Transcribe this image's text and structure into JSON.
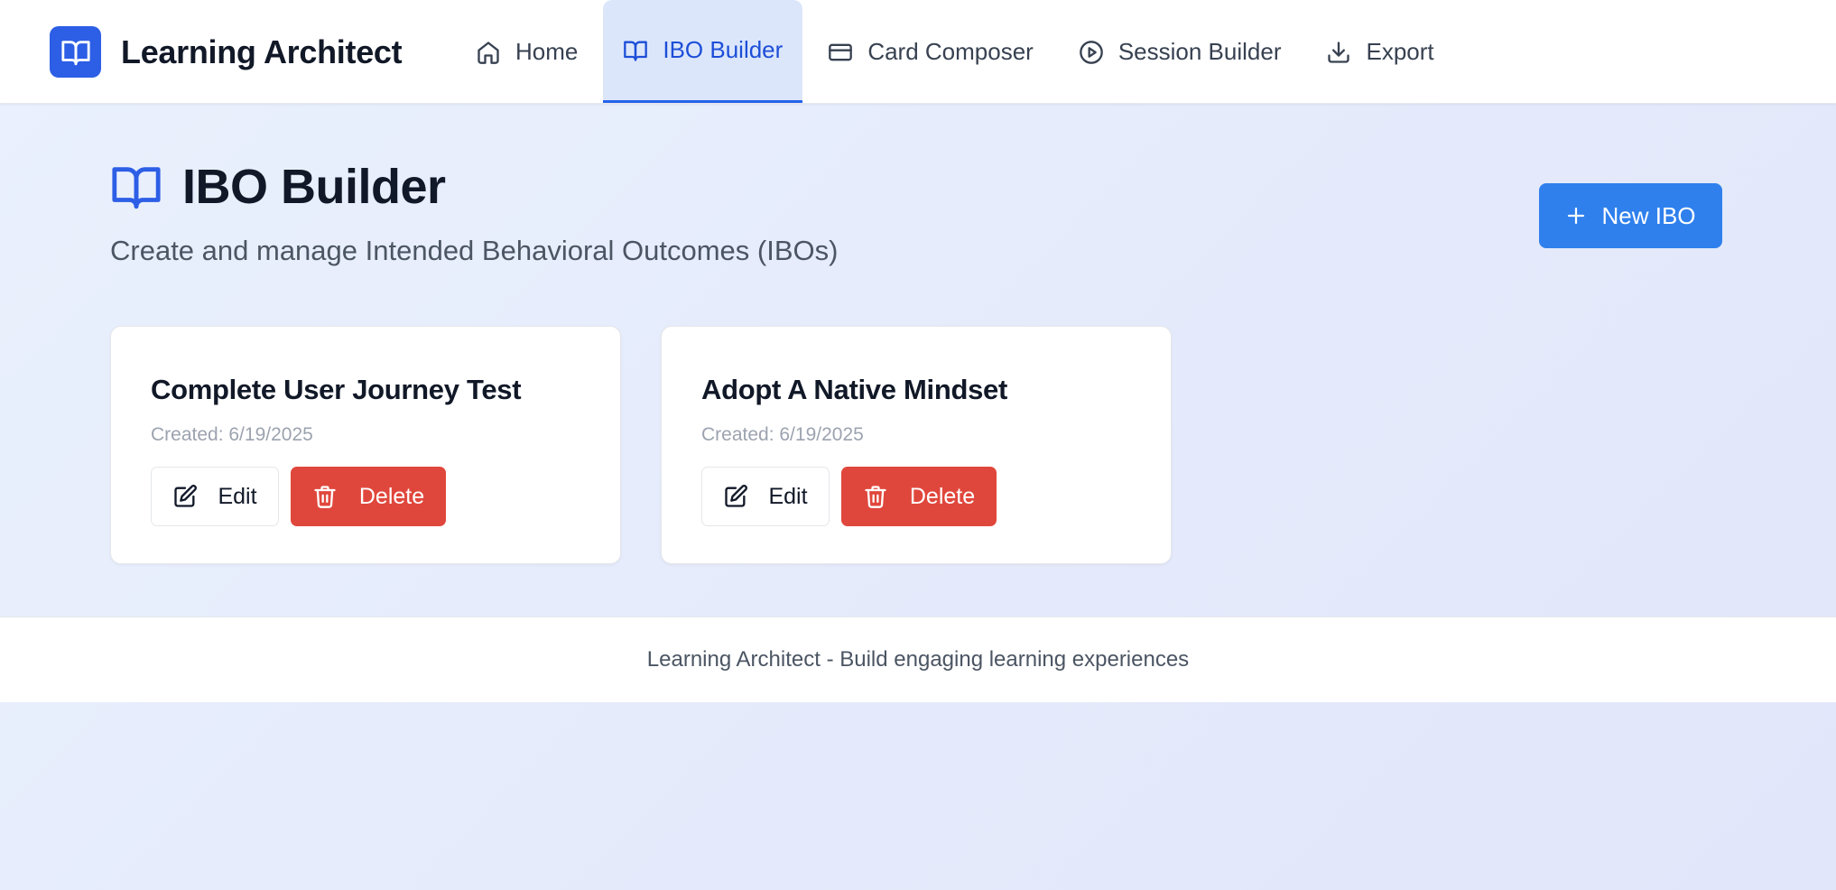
{
  "app": {
    "name": "Learning Architect",
    "logo_icon": "book-open-icon",
    "accent_color": "#2d5ee6"
  },
  "nav": {
    "items": [
      {
        "label": "Home",
        "icon": "home-icon",
        "active": false
      },
      {
        "label": "IBO Builder",
        "icon": "book-open-icon",
        "active": true
      },
      {
        "label": "Card Composer",
        "icon": "credit-card-icon",
        "active": false
      },
      {
        "label": "Session Builder",
        "icon": "play-circle-icon",
        "active": false
      },
      {
        "label": "Export",
        "icon": "download-icon",
        "active": false
      }
    ]
  },
  "page": {
    "title": "IBO Builder",
    "subtitle": "Create and manage Intended Behavioral Outcomes (IBOs)",
    "new_button_label": "New IBO"
  },
  "cards": [
    {
      "title": "Complete User Journey Test",
      "created": "Created: 6/19/2025",
      "edit_label": "Edit",
      "delete_label": "Delete"
    },
    {
      "title": "Adopt A Native Mindset",
      "created": "Created: 6/19/2025",
      "edit_label": "Edit",
      "delete_label": "Delete"
    }
  ],
  "footer": {
    "text": "Learning Architect - Build engaging learning experiences"
  },
  "colors": {
    "primary_button": "#2f80ed",
    "delete_button": "#e0473c",
    "active_nav_bg": "#dbe6fb",
    "active_nav_text": "#1d4ed8"
  }
}
